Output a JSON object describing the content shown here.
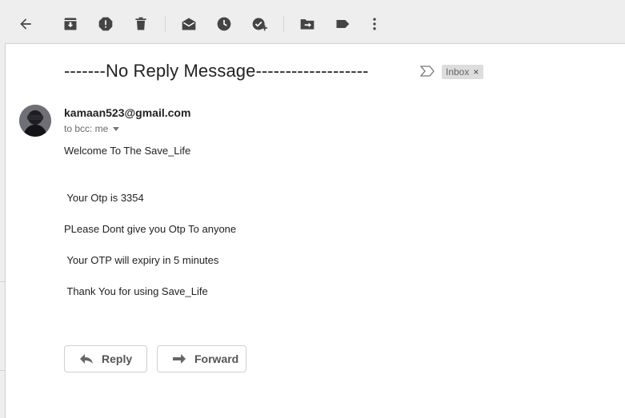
{
  "toolbar": {
    "icons": [
      "back-arrow-icon",
      "archive-icon",
      "report-spam-icon",
      "delete-icon",
      "mark-unread-icon",
      "snooze-icon",
      "add-to-tasks-icon",
      "move-to-icon",
      "labels-icon",
      "more-icon"
    ]
  },
  "message": {
    "subject": "-------No Reply Message-------------------",
    "label": "Inbox",
    "label_close": "×",
    "sender": "kamaan523@gmail.com",
    "to_line": "to bcc: me",
    "body": {
      "line1": "Welcome To The Save_Life",
      "line2": " Your Otp is 3354",
      "line3": "PLease Dont give you Otp To anyone",
      "line4": " Your OTP will expiry in 5 minutes",
      "line5": " Thank You for using Save_Life"
    }
  },
  "actions": {
    "reply_label": "Reply",
    "forward_label": "Forward"
  },
  "colors": {
    "background": "#eeeeee",
    "panel": "#ffffff",
    "icon": "#444444",
    "label_chip": "#dddddd"
  }
}
